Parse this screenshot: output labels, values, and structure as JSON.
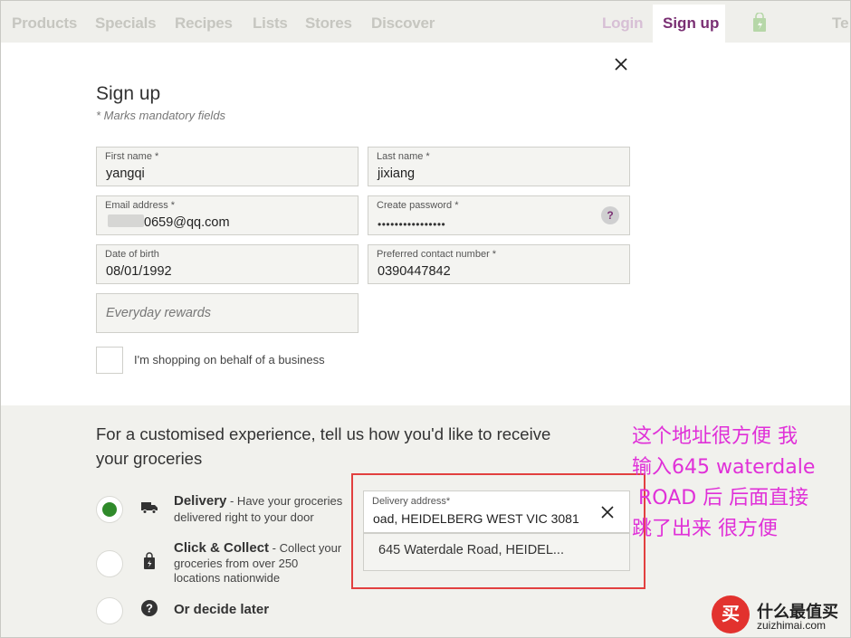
{
  "nav": {
    "items": [
      "Products",
      "Specials",
      "Recipes",
      "Lists",
      "Stores",
      "Discover"
    ],
    "login": "Login",
    "signup": "Sign up",
    "cut_text": "Te"
  },
  "form": {
    "title": "Sign up",
    "mandatory_note": "* Marks mandatory fields",
    "first_name": {
      "label": "First name *",
      "value": "yangqi"
    },
    "last_name": {
      "label": "Last name *",
      "value": "jixiang"
    },
    "email": {
      "label": "Email address *",
      "value": "0659@qq.com"
    },
    "password": {
      "label": "Create password *",
      "value": "••••••••••••••••",
      "help": "?"
    },
    "dob": {
      "label": "Date of birth",
      "value": "08/01/1992"
    },
    "phone": {
      "label": "Preferred contact number *",
      "value": "0390447842"
    },
    "rewards_placeholder": "Everyday rewards",
    "business_label": "I'm shopping on behalf of a business"
  },
  "delivery": {
    "heading": "For a customised experience, tell us how you'd like to receive your groceries",
    "options": [
      {
        "title": "Delivery",
        "desc_line1": " - Have your groceries",
        "desc_line2": "delivered right to your door",
        "selected": true
      },
      {
        "title": "Click & Collect",
        "desc_line1": " - Collect your",
        "desc_line2": "groceries from over 250",
        "desc_line3": "locations nationwide",
        "selected": false
      },
      {
        "title": "Or decide later",
        "selected": false
      }
    ],
    "address": {
      "label": "Delivery address*",
      "value": "oad, HEIDELBERG WEST  VIC  3081"
    },
    "suggestion": "645 Waterdale Road, HEIDEL..."
  },
  "annotation": {
    "lines": [
      "这个地址很方便 我",
      "输入645 waterdale",
      " ROAD 后 后面直接",
      "跳了出来 很方便"
    ]
  },
  "watermark": {
    "glyph": "买",
    "text": "什么最值买",
    "url": "zuizhimai.com"
  },
  "colors": {
    "accent": "#7a2f73",
    "selected_radio": "#2f8a2a",
    "annotation_red": "#e2403f",
    "annotation_text": "#e030d8"
  }
}
